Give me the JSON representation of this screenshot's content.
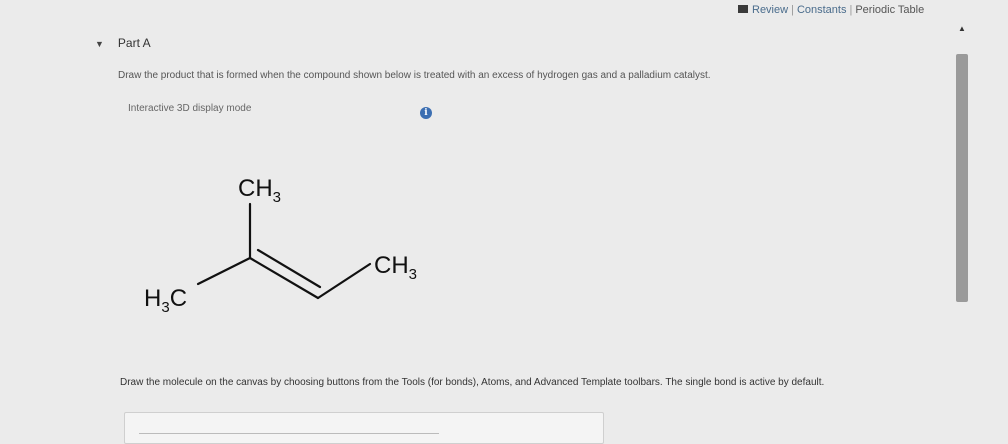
{
  "header": {
    "links": [
      "Review",
      "Constants",
      "Periodic Table"
    ],
    "separator": "|"
  },
  "part": {
    "title": "Part A",
    "question": "Draw the product that is formed when the compound shown below is treated with an excess of hydrogen gas and a palladium catalyst.",
    "display_mode": "Interactive 3D display mode",
    "info_glyph": "i"
  },
  "molecule": {
    "labels": {
      "top_ch3": "CH",
      "top_ch3_sub": "3",
      "right_ch3": "CH",
      "right_ch3_sub": "3",
      "left_h3c_h": "H",
      "left_h3c_sub": "3",
      "left_h3c_c": "C"
    }
  },
  "instructions": "Draw the molecule on the canvas by choosing buttons from the Tools (for bonds), Atoms, and Advanced Template toolbars. The single bond is active by default.",
  "colors": {
    "link": "#4a6c8c",
    "info": "#3c6fb2"
  }
}
